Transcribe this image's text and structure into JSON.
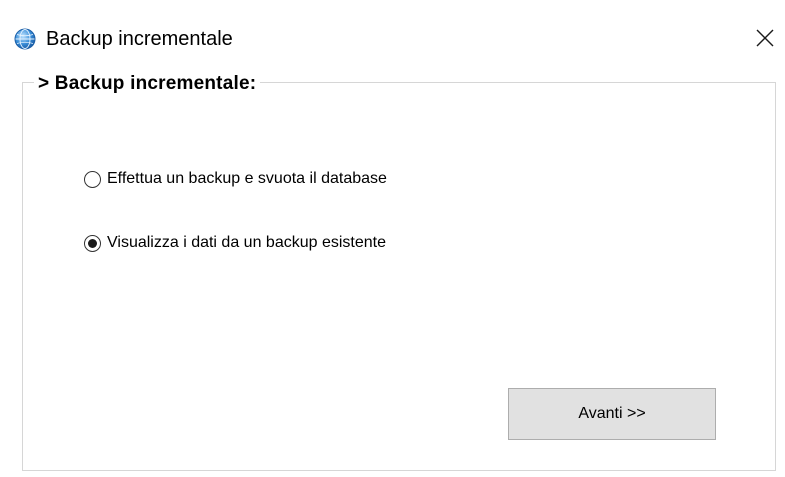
{
  "window": {
    "title": "Backup incrementale",
    "app_icon": "backup-globe-icon",
    "close_icon": "close-icon"
  },
  "group": {
    "legend": "> Backup incrementale:"
  },
  "options": [
    {
      "label": "Effettua un backup e svuota il database",
      "selected": false
    },
    {
      "label": "Visualizza i dati da un backup esistente",
      "selected": true
    }
  ],
  "buttons": {
    "next_label": "Avanti >>"
  },
  "colors": {
    "button_face": "#e1e1e1",
    "button_border": "#adadad",
    "group_border": "#d6d6d6",
    "icon_blue": "#3b8fd9"
  }
}
